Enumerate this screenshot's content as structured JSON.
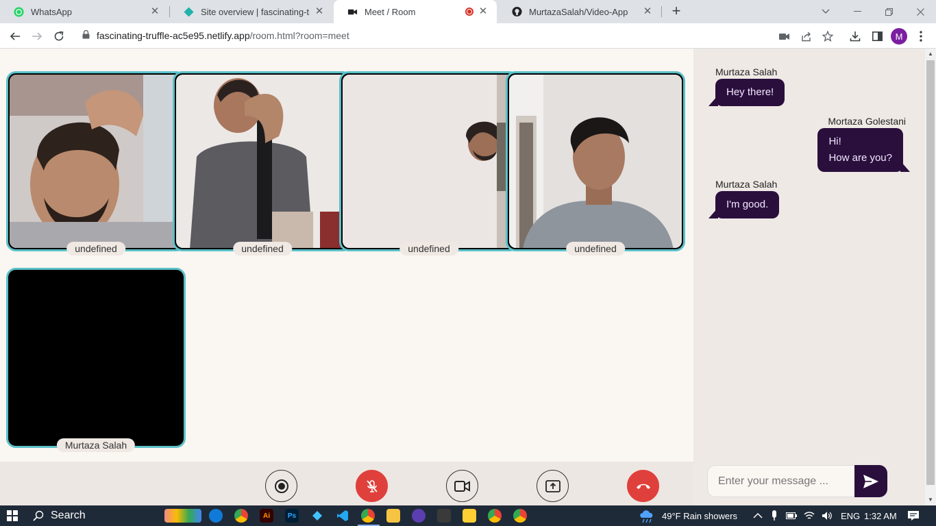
{
  "browser": {
    "tabs": [
      {
        "title": "WhatsApp",
        "icon": "whatsapp-icon",
        "color": "#25d366"
      },
      {
        "title": "Site overview | fascinating-truffle",
        "icon": "netlify-icon",
        "color": "#20b2aa"
      },
      {
        "title": "Meet / Room",
        "icon": "camera-icon",
        "color": "#202124",
        "active": true
      },
      {
        "title": "MurtazaSalah/Video-App",
        "icon": "github-icon",
        "color": "#202124"
      }
    ],
    "close_glyph": "✕",
    "new_tab_glyph": "+",
    "url_host": "fascinating-truffle-ac5e95.netlify.app",
    "url_path": "/room.html?room=meet",
    "profile_initial": "M"
  },
  "videos": [
    {
      "label": "undefined"
    },
    {
      "label": "undefined"
    },
    {
      "label": "undefined"
    },
    {
      "label": "undefined"
    },
    {
      "label": "Murtaza Salah"
    }
  ],
  "controls": [
    {
      "name": "record-button",
      "icon": "record-icon"
    },
    {
      "name": "mute-button",
      "icon": "mic-off-icon",
      "color": "#e0403b"
    },
    {
      "name": "camera-button",
      "icon": "video-icon"
    },
    {
      "name": "share-screen-button",
      "icon": "screen-share-icon"
    },
    {
      "name": "leave-call-button",
      "icon": "phone-hangup-icon",
      "color": "#e0403b"
    }
  ],
  "chat": {
    "messages": [
      {
        "sender": "Murtaza Salah",
        "text": "Hey there!",
        "side": "left"
      },
      {
        "sender": "Mortaza Golestani",
        "text_line1": "Hi!",
        "text_line2": "How are you?",
        "side": "right"
      },
      {
        "sender": "Murtaza Salah",
        "text": "I'm good.",
        "side": "left"
      }
    ],
    "input_placeholder": "Enter your message ...",
    "accent": "#2a0f3d"
  },
  "taskbar": {
    "search_label": "Search",
    "weather": "49°F  Rain showers",
    "language": "ENG",
    "time": "1:32 AM"
  }
}
